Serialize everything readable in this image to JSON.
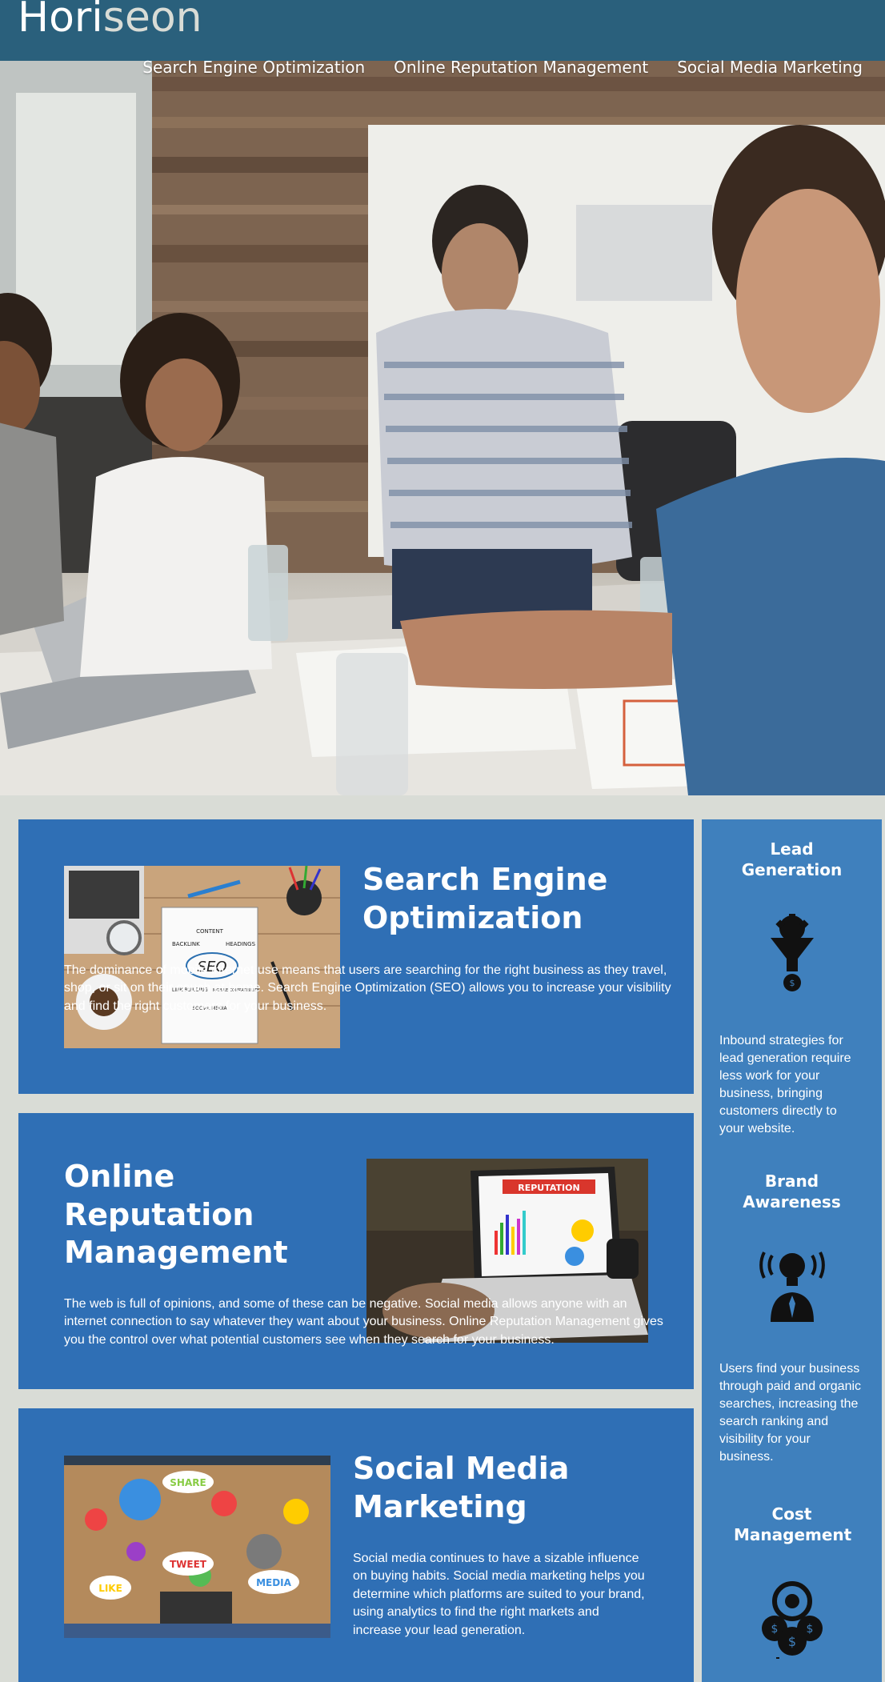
{
  "header": {
    "logo_part1": "Hori",
    "logo_part2": "seon",
    "nav": [
      {
        "label": "Search Engine Optimization"
      },
      {
        "label": "Online Reputation Management"
      },
      {
        "label": "Social Media Marketing"
      }
    ]
  },
  "cards": [
    {
      "title": "Search Engine Optimization",
      "body": "The dominance of mobile internet use means that users are searching for the right business as they travel, shop, or sit on their couch at home. Search Engine Optimization (SEO) allows you to increase your visibility and find the right customers for your business.",
      "image": {
        "labels": [
          "CONTENT",
          "BACKLINK",
          "HEADINGS",
          "SEO",
          "LINK BUILDING",
          "MOBILE COMPATIBILITY",
          "SOCIAL MEDIA"
        ]
      }
    },
    {
      "title": "Online Reputation Management",
      "body": "The web is full of opinions, and some of these can be negative. Social media allows anyone with an internet connection to say whatever they want about your business. Online Reputation Management gives you the control over what potential customers see when they search for your business.",
      "image": {
        "label": "REPUTATION"
      }
    },
    {
      "title": "Social Media Marketing",
      "body": "Social media continues to have a sizable influence on buying habits. Social media marketing helps you determine which platforms are suited to your brand, using analytics to find the right markets and increase your lead generation.",
      "image": {
        "labels": [
          "SHARE",
          "TWEET",
          "LIKE",
          "MEDIA"
        ]
      }
    }
  ],
  "benefits": [
    {
      "title": "Lead Generation",
      "icon": "lead-funnel-icon",
      "body": "Inbound strategies for lead generation require less work for your business, bringing customers directly to your website."
    },
    {
      "title": "Brand Awareness",
      "icon": "brand-lightbulb-icon",
      "body": "Users find your business through paid and organic searches, increasing the search ranking and visibility for your business."
    },
    {
      "title": "Cost Management",
      "icon": "cost-coins-icon",
      "body": ""
    }
  ],
  "colors": {
    "header_bg": "#2a607c",
    "card_bg": "#2f6fb5",
    "aside_bg": "#3f80bd",
    "page_bg": "#d9dcd6"
  }
}
